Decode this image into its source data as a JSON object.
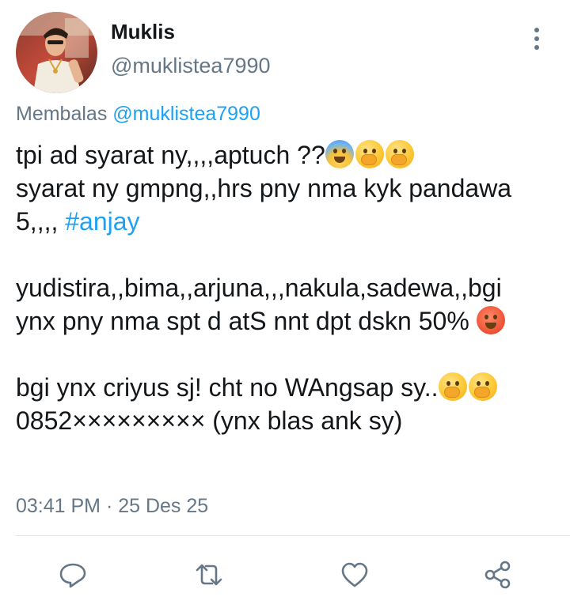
{
  "user": {
    "display_name": "Muklis",
    "handle": "@muklistea7990"
  },
  "reply_context": {
    "prefix": "Membalas",
    "target": "@muklistea7990"
  },
  "tweet": {
    "lines": [
      "tpi ad syarat ny,,,,aptuch ??",
      "syarat ny gmpng,,hrs pny nma kyk pandawa",
      "5,,,,",
      "yudistira,,bima,,arjuna,,,nakula,sadewa,,bgi",
      "ynx pny nma spt d atS nnt dpt dskn 50%",
      "bgi ynx criyus sj! cht no WAngsap sy..",
      "0852××××××××× (ynx blas ank sy)"
    ],
    "hashtag": "#anjay",
    "emojis": [
      "face-screaming-icon",
      "shushing-face-icon",
      "hand-over-mouth-icon",
      "hot-face-icon"
    ]
  },
  "timestamp": "03:41 PM · 25 Des 25",
  "actions": {
    "reply": "reply-icon",
    "retweet": "retweet-icon",
    "like": "like-icon",
    "share": "share-icon"
  },
  "colors": {
    "accent": "#1da1f2",
    "secondary_text": "#657786",
    "primary_text": "#14171a",
    "divider": "#e1e8ed"
  }
}
